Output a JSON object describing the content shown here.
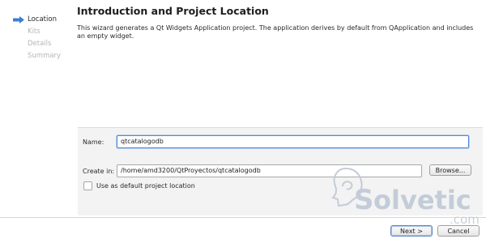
{
  "steps": [
    {
      "label": "Location",
      "active": true
    },
    {
      "label": "Kits",
      "active": false
    },
    {
      "label": "Details",
      "active": false
    },
    {
      "label": "Summary",
      "active": false
    }
  ],
  "page": {
    "title": "Introduction and Project Location",
    "description": "This wizard generates a Qt Widgets Application project. The application derives by default from QApplication and includes an empty widget."
  },
  "form": {
    "name_label": "Name:",
    "name_value": "qtcatalogodb",
    "create_in_label": "Create in:",
    "create_in_value": "/home/amd3200/QtProyectos/qtcatalogodb",
    "browse_label": "Browse...",
    "default_location_label": "Use as default project location",
    "default_location_checked": false
  },
  "buttons": {
    "next_label": "Next >",
    "cancel_label": "Cancel"
  },
  "watermark": {
    "brand": "olvetic",
    "suffix": ".com"
  },
  "colors": {
    "active_arrow": "#3b7fd4",
    "focus_border": "#4f8ad9",
    "watermark": "#bfc9d6"
  }
}
